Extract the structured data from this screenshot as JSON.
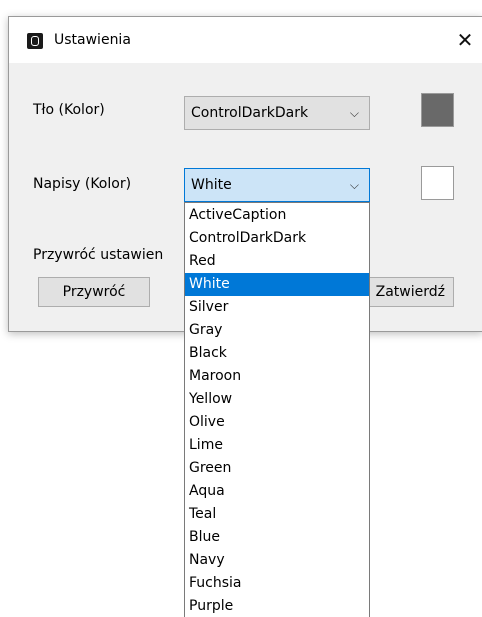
{
  "window": {
    "title": "Ustawienia",
    "close_glyph": "✕"
  },
  "background_row": {
    "label": "Tło (Kolor)",
    "selected": "ControlDarkDark",
    "swatch_color": "#696969"
  },
  "text_row": {
    "label": "Napisy (Kolor)",
    "selected": "White",
    "swatch_color": "#ffffff"
  },
  "reset": {
    "label": "Przywróć ustawien",
    "button": "Przywróć"
  },
  "confirm": {
    "button": "Zatwierdź"
  },
  "dropdown": {
    "selected_index": 3,
    "options": [
      "ActiveCaption",
      "ControlDarkDark",
      "Red",
      "White",
      "Silver",
      "Gray",
      "Black",
      "Maroon",
      "Yellow",
      "Olive",
      "Lime",
      "Green",
      "Aqua",
      "Teal",
      "Blue",
      "Navy",
      "Fuchsia",
      "Purple"
    ]
  },
  "icons": {
    "app": "app-icon",
    "close": "close-icon",
    "chevron": "chevron-down-icon"
  },
  "colors": {
    "accent": "#0078d7",
    "selection_bg": "#cce4f7"
  }
}
